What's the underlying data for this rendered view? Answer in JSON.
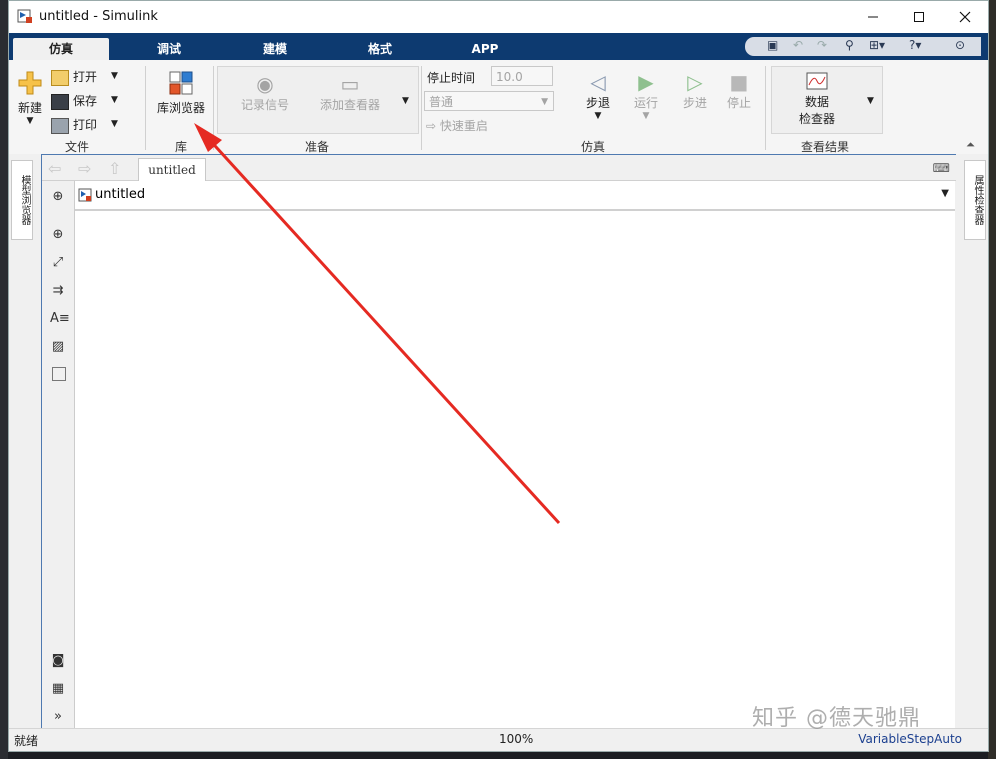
{
  "window": {
    "title": "untitled - Simulink"
  },
  "menu_tabs": [
    {
      "label": "仿真",
      "active": true
    },
    {
      "label": "调试",
      "active": false
    },
    {
      "label": "建模",
      "active": false
    },
    {
      "label": "格式",
      "active": false
    },
    {
      "label": "APP",
      "active": false
    }
  ],
  "ribbon": {
    "file": {
      "new_label": "新建",
      "open_label": "打开",
      "save_label": "保存",
      "print_label": "打印",
      "section_label": "文件"
    },
    "library": {
      "browser_label": "库浏览器",
      "section_label": "库"
    },
    "prepare": {
      "log_signals_label": "记录信号",
      "add_viewer_label": "添加查看器",
      "section_label": "准备"
    },
    "simulation": {
      "stop_time_label": "停止时间",
      "stop_time_value": "10.0",
      "mode_value": "普通",
      "fast_restart_label": "快速重启",
      "step_back_label": "步退",
      "run_label": "运行",
      "step_forward_label": "步进",
      "stop_label": "停止",
      "section_label": "仿真"
    },
    "results": {
      "data_inspector_line1": "数据",
      "data_inspector_line2": "检查器",
      "section_label": "查看结果"
    }
  },
  "side_panels": {
    "left_label": "模型浏览器",
    "right_label": "属性检查器"
  },
  "editor": {
    "doc_tab": "untitled",
    "address": "untitled"
  },
  "status": {
    "left": "就绪",
    "zoom": "100%",
    "solver": "VariableStepAuto"
  },
  "watermark": "知乎 @德天驰鼎",
  "colors": {
    "menu_bar": "#0d3a70",
    "annotation_arrow": "#e52a22",
    "editor_border": "#4e79b0"
  }
}
